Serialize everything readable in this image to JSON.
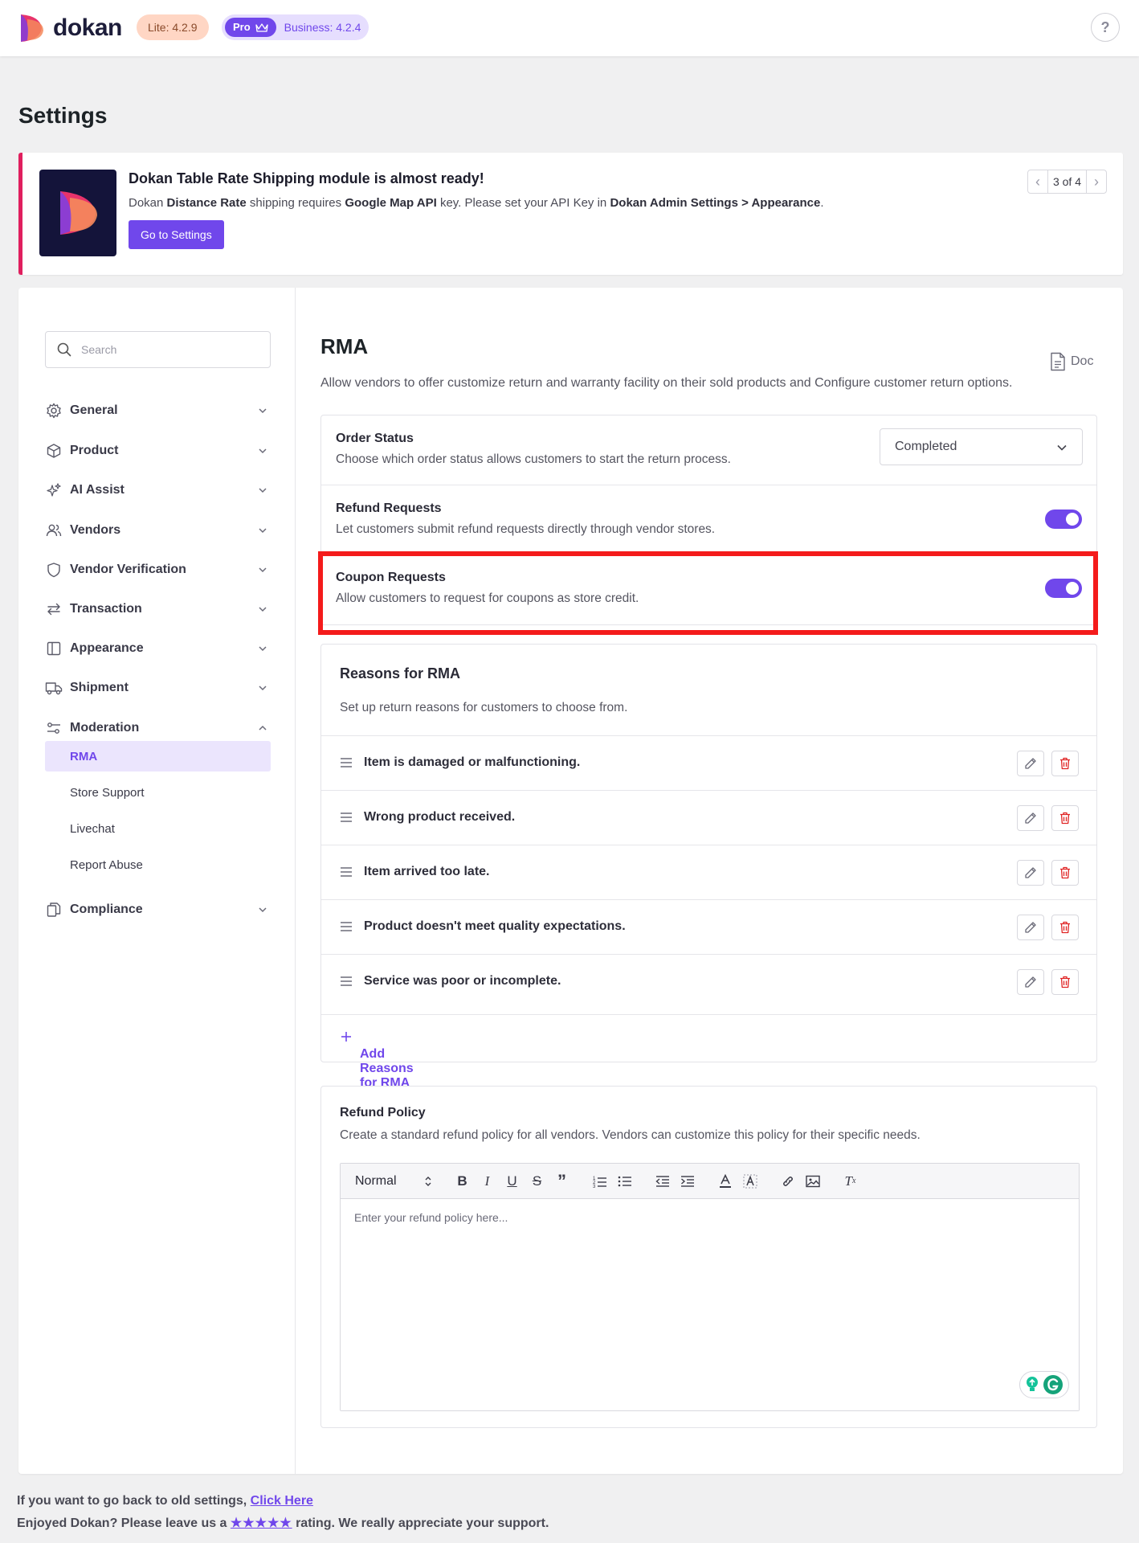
{
  "header": {
    "logo_text": "dokan",
    "lite_badge": "Lite: 4.2.9",
    "pro_badge": "Pro",
    "business_badge": "Business: 4.2.4",
    "help_label": "?"
  },
  "page_title": "Settings",
  "notice": {
    "title": "Dokan Table Rate Shipping module is almost ready!",
    "text_parts": [
      "Dokan ",
      "Distance Rate",
      " shipping requires ",
      "Google Map API",
      " key. Please set your API Key in ",
      "Dokan Admin Settings > Appearance",
      "."
    ],
    "button": "Go to Settings",
    "pager": "3 of 4"
  },
  "sidebar": {
    "search_placeholder": "Search",
    "items": [
      {
        "label": "General",
        "icon": "gear-icon"
      },
      {
        "label": "Product",
        "icon": "box-icon"
      },
      {
        "label": "AI Assist",
        "icon": "sparkle-icon"
      },
      {
        "label": "Vendors",
        "icon": "users-icon"
      },
      {
        "label": "Vendor Verification",
        "icon": "shield-icon"
      },
      {
        "label": "Transaction",
        "icon": "arrows-icon"
      },
      {
        "label": "Appearance",
        "icon": "book-icon"
      },
      {
        "label": "Shipment",
        "icon": "truck-icon"
      },
      {
        "label": "Moderation",
        "icon": "sliders-icon"
      }
    ],
    "sub_items": [
      "RMA",
      "Store Support",
      "Livechat",
      "Report Abuse"
    ],
    "compliance": {
      "label": "Compliance",
      "icon": "copy-icon"
    }
  },
  "content": {
    "title": "RMA",
    "description": "Allow vendors to offer customize return and warranty facility on their sold products and Configure customer return options.",
    "doc_label": "Doc",
    "order_status": {
      "title": "Order Status",
      "description": "Choose which order status allows customers to start the return process.",
      "value": "Completed"
    },
    "refund_requests": {
      "title": "Refund Requests",
      "description": "Let customers submit refund requests directly through vendor stores.",
      "enabled": true
    },
    "coupon_requests": {
      "title": "Coupon Requests",
      "description": "Allow customers to request for coupons as store credit.",
      "enabled": true
    },
    "reasons": {
      "title": "Reasons for RMA",
      "description": "Set up return reasons for customers to choose from.",
      "items": [
        "Item is damaged or malfunctioning.",
        "Wrong product received.",
        "Item arrived too late.",
        "Product doesn't meet quality expectations.",
        "Service was poor or incomplete."
      ],
      "add_label": "Add Reasons for RMA"
    },
    "refund_policy": {
      "title": "Refund Policy",
      "description": "Create a standard refund policy for all vendors. Vendors can customize this policy for their specific needs.",
      "format_value": "Normal",
      "placeholder": "Enter your refund policy here..."
    }
  },
  "footer": {
    "line1_prefix": "If you want to go back to old settings, ",
    "line1_link": "Click Here",
    "line2_prefix": "Enjoyed Dokan? Please leave us a ",
    "line2_stars": "★★★★★",
    "line2_suffix": " rating. We really appreciate your support."
  },
  "colors": {
    "accent": "#7047eb",
    "notice_border": "#e01f5e",
    "highlight": "#f41b1b",
    "delete": "#e02424"
  }
}
